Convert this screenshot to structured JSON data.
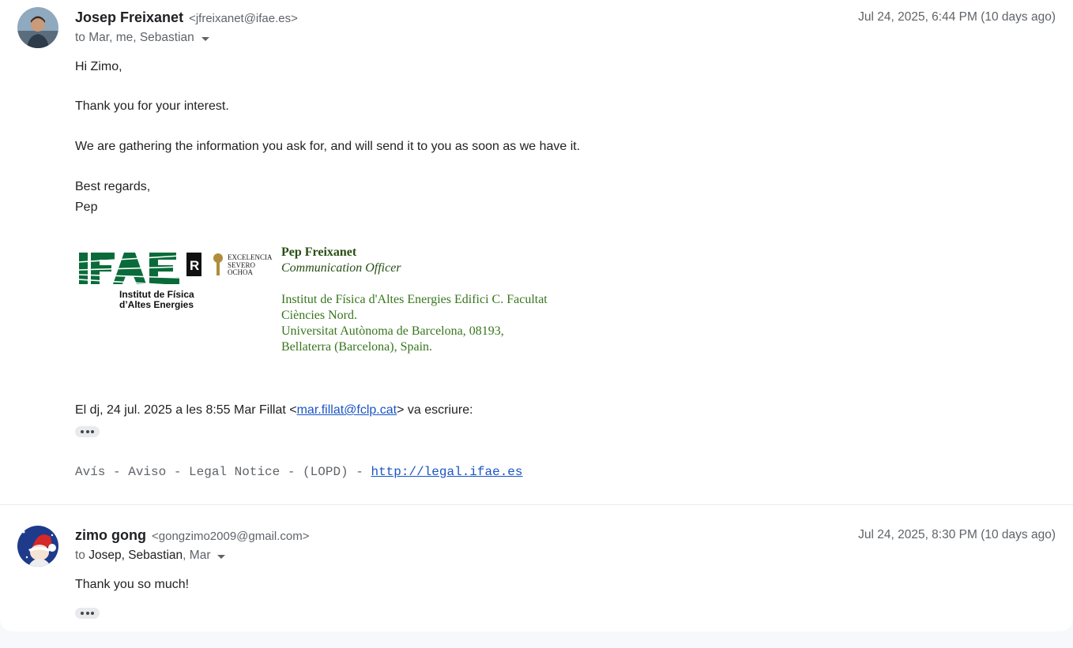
{
  "messages": [
    {
      "sender_name": "Josep Freixanet",
      "sender_email": "<jfreixanet@ifae.es>",
      "to_prefix": "to",
      "recipients": "Mar, me, Sebastian",
      "date": "Jul 24, 2025, 6:44 PM (10 days ago)",
      "body": {
        "greeting": "Hi Zimo,",
        "line1": "Thank you for your interest.",
        "line2": "We are gathering the information you ask for, and will send it to you as soon as we have it.",
        "closing": "Best regards,",
        "sign_name": "Pep"
      },
      "signature": {
        "logo_text": "IFAE",
        "logo_subtitle_1": "Institut de Física",
        "logo_subtitle_2": "d’Altes Energies",
        "excelencia_1": "EXCELENCIA",
        "excelencia_2": "SEVERO",
        "excelencia_3": "OCHOA",
        "name": "Pep Freixanet",
        "role": "Communication Officer",
        "address_1": "Institut de Física d'Altes Energies Edifici C. Facultat",
        "address_2": "Ciències Nord.",
        "address_3": "Universitat Autònoma de Barcelona, 08193,",
        "address_4": "Bellaterra (Barcelona), Spain."
      },
      "quote_prefix": "El dj, 24 jul. 2025 a les 8:55 Mar Fillat <",
      "quote_email": "mar.fillat@fclp.cat",
      "quote_suffix": "> va escriure:",
      "legal_text": "Avís - Aviso - Legal Notice - (LOPD) - ",
      "legal_link": "http://legal.ifae.es"
    },
    {
      "sender_name": "zimo gong",
      "sender_email": "<gongzimo2009@gmail.com>",
      "to_prefix": "to",
      "recipients_dark": "Josep, Sebastian",
      "recipients_light": ", Mar",
      "date": "Jul 24, 2025, 8:30 PM (10 days ago)",
      "body": {
        "line1": "Thank you so much!"
      }
    }
  ],
  "colors": {
    "signature_green": "#38761d",
    "ifae_green": "#0a6b3a",
    "severo_gold": "#b08d3c",
    "link_blue": "#1a55c4"
  }
}
